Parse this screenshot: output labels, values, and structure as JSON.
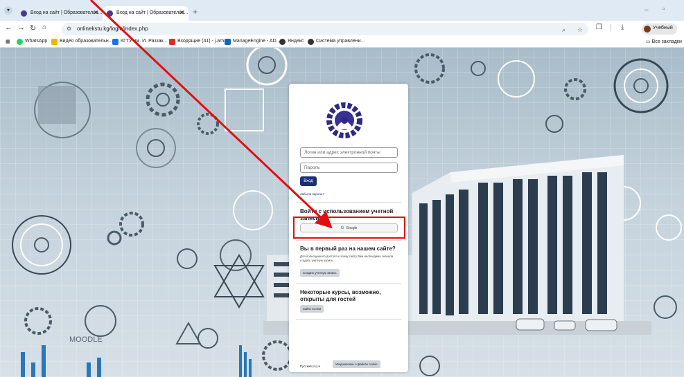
{
  "browser": {
    "tabs": [
      {
        "title": "Вход на сайт | Образовательн..."
      },
      {
        "title": "Вход на сайт | Образовательн..."
      }
    ],
    "new_tab": "+",
    "window_minimize": "–",
    "window_restore": "▫",
    "url": "onlinekstu.kg/login/index.php",
    "profile_name": "Учебный",
    "bookmarks": [
      {
        "label": "WhatsApp",
        "color": "#25d366"
      },
      {
        "label": "Видео образовательн...",
        "color": "#f4b400"
      },
      {
        "label": "КГТУ им. И. Раззак...",
        "color": "#1a73e8"
      },
      {
        "label": "Входящие (41) - j.am...",
        "color": "#d93025"
      },
      {
        "label": "ManageEngine - AD...",
        "color": "#1565c0"
      },
      {
        "label": "Яндекс",
        "color": "#333333"
      },
      {
        "label": "Система управлени...",
        "color": "#333333"
      }
    ],
    "all_bookmarks": "Все закладки"
  },
  "login": {
    "username_placeholder": "Логин или адрес электронной почты",
    "password_placeholder": "Пароль",
    "login_button": "Вход",
    "forgot_password": "Забыли пароль?",
    "sso_title": "Войти с использованием учетной записи:",
    "google_button": "Google",
    "first_time_title": "Вы в первый раз на нашем сайте?",
    "first_time_text": "Для полноценного доступа к этому сайту Вам необходимо сначала создать учетную запись.",
    "create_account_button": "Создать учетную запись",
    "guest_title": "Некоторые курсы, возможно, открыты для гостей",
    "guest_button": "Зайти гостем",
    "language": "Русский (ru) ▾",
    "cookies_button": "Уведомление о файлах cookie"
  },
  "background": {
    "moodle_text": "MOODLE"
  },
  "colors": {
    "primary": "#1a2f7a",
    "annotation": "#e01010"
  }
}
